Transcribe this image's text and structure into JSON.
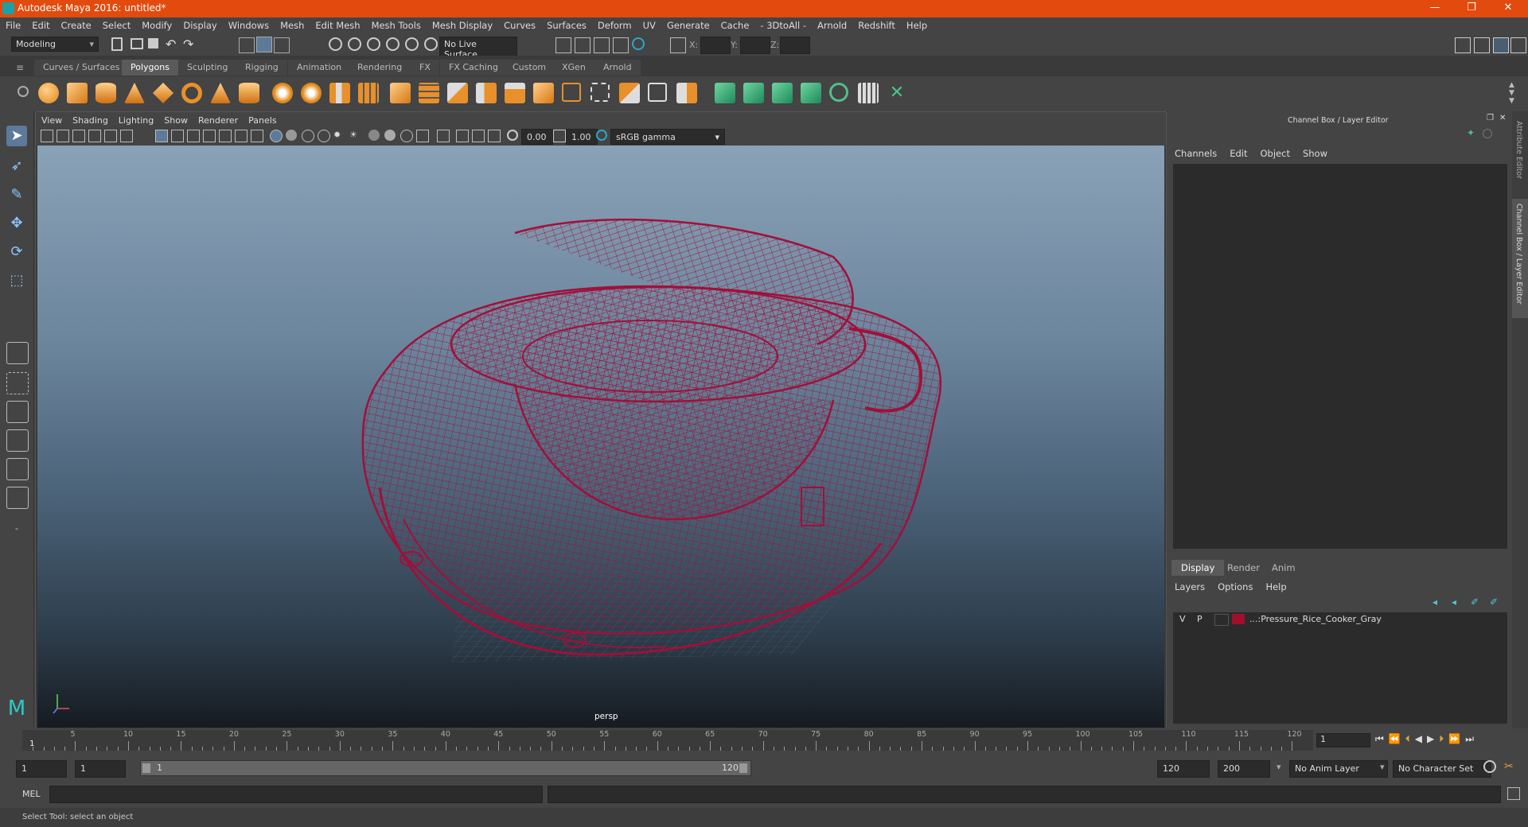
{
  "window": {
    "title": "Autodesk Maya 2016: untitled*",
    "minimize": "—",
    "maximize": "❐",
    "close": "✕"
  },
  "menus": [
    "File",
    "Edit",
    "Create",
    "Select",
    "Modify",
    "Display",
    "Windows",
    "Mesh",
    "Edit Mesh",
    "Mesh Tools",
    "Mesh Display",
    "Curves",
    "Surfaces",
    "Deform",
    "UV",
    "Generate",
    "Cache",
    "- 3DtoAll -",
    "Arnold",
    "Redshift",
    "Help"
  ],
  "status": {
    "mode": "Modeling",
    "live_surface": "No Live Surface",
    "x_label": "X:",
    "y_label": "Y:",
    "z_label": "Z:"
  },
  "shelf_tabs": [
    "Curves / Surfaces",
    "Polygons",
    "Sculpting",
    "Rigging",
    "Animation",
    "Rendering",
    "FX",
    "FX Caching",
    "Custom",
    "XGen",
    "Arnold"
  ],
  "shelf_active": "Polygons",
  "viewport": {
    "menus": [
      "View",
      "Shading",
      "Lighting",
      "Show",
      "Renderer",
      "Panels"
    ],
    "exposure": "0.00",
    "gamma": "1.00",
    "color_space": "sRGB gamma",
    "camera_label": "persp",
    "wire_color": "#a0103a"
  },
  "channel_box": {
    "title": "Channel Box / Layer Editor",
    "menus": [
      "Channels",
      "Edit",
      "Object",
      "Show"
    ],
    "display_tabs": [
      "Display",
      "Render",
      "Anim"
    ],
    "display_active": "Display",
    "layer_menus": [
      "Layers",
      "Options",
      "Help"
    ],
    "layer": {
      "v": "V",
      "p": "P",
      "name": "...:Pressure_Rice_Cooker_Gray",
      "color": "#a0102a"
    }
  },
  "side_tabs": {
    "attribute_editor": "Attribute Editor",
    "channel_box": "Channel Box / Layer Editor"
  },
  "timeline": {
    "labels": [
      "5",
      "10",
      "15",
      "20",
      "25",
      "30",
      "35",
      "40",
      "45",
      "50",
      "55",
      "60",
      "65",
      "70",
      "75",
      "80",
      "85",
      "90",
      "95",
      "100",
      "105",
      "110",
      "115",
      "120"
    ],
    "start_marker": "1",
    "current_frame": "1"
  },
  "range": {
    "start": "1",
    "inner_start": "1",
    "slider_start": "1",
    "slider_end": "120",
    "end": "120",
    "max": "200",
    "anim_layer": "No Anim Layer",
    "char_set": "No Character Set"
  },
  "command": {
    "label": "MEL"
  },
  "help_line": "Select Tool: select an object"
}
